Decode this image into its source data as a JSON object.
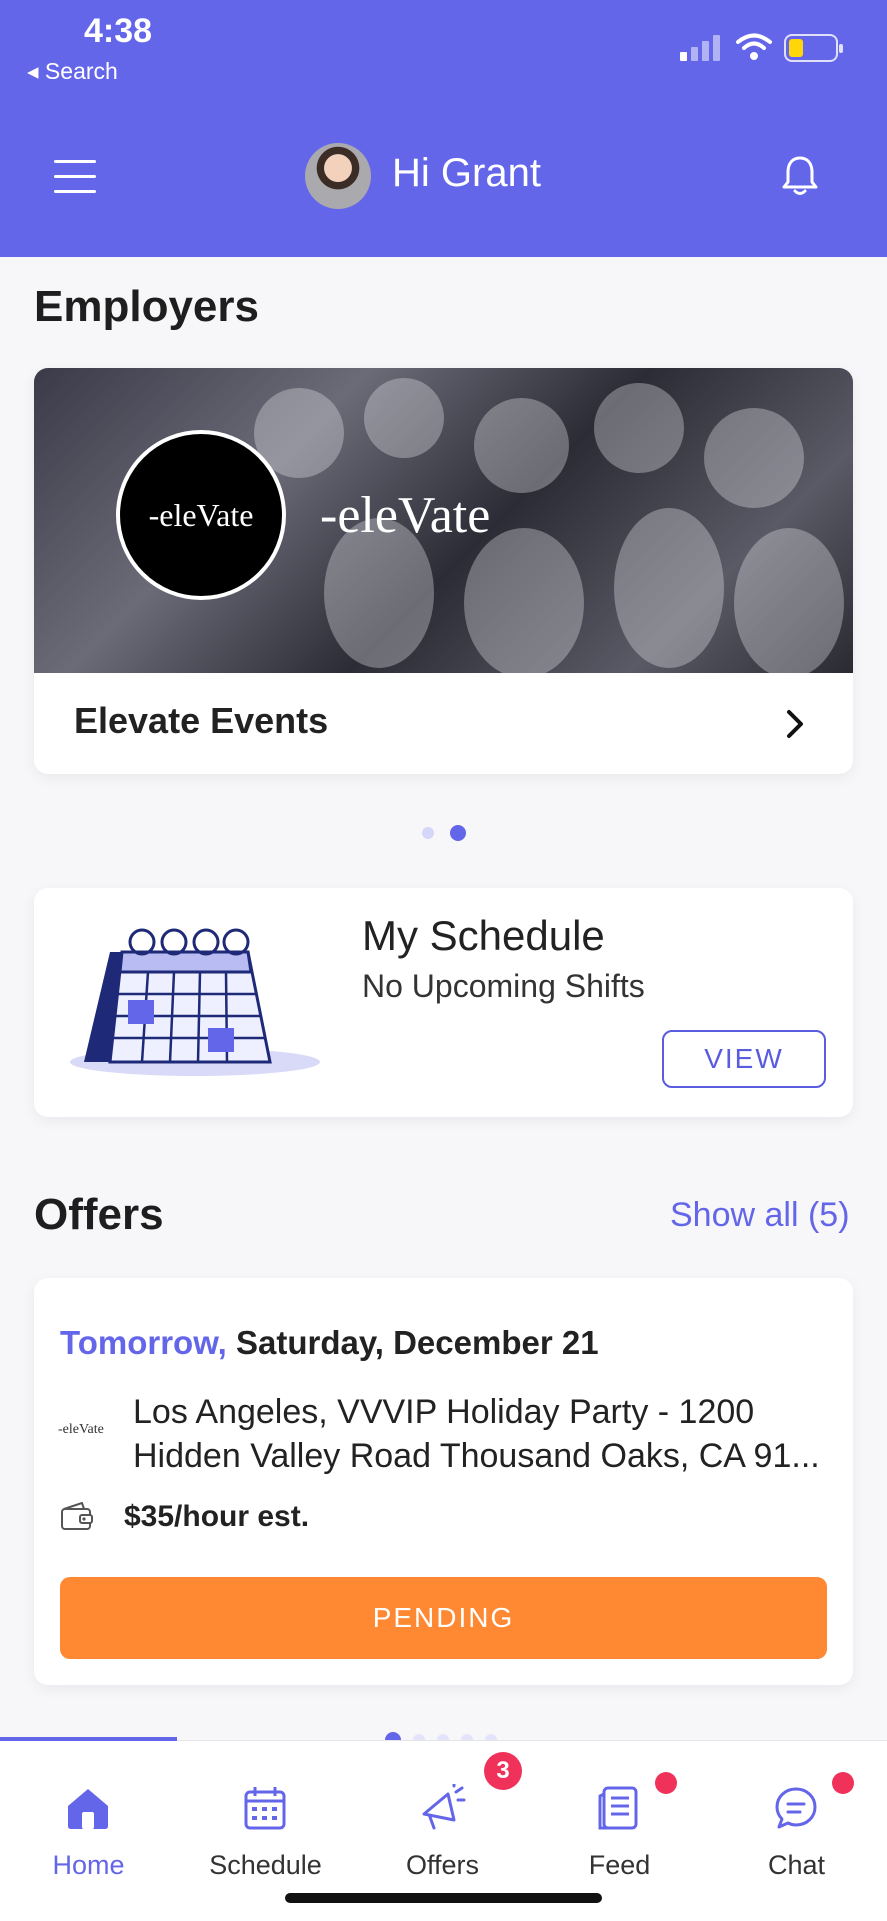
{
  "status_bar": {
    "time": "4:38",
    "back_label": "◂ Search"
  },
  "header": {
    "greeting": "Hi Grant"
  },
  "employers": {
    "title": "Employers",
    "card": {
      "logo_text": "-eleVate",
      "wordmark": "-eleVate",
      "name": "Elevate Events"
    },
    "carousel": {
      "count": 2,
      "active_index": 1
    }
  },
  "schedule": {
    "title": "My Schedule",
    "subtitle": "No Upcoming Shifts",
    "view_label": "VIEW"
  },
  "offers": {
    "title": "Offers",
    "show_all": "Show all (5)",
    "card": {
      "date_prefix": "Tomorrow,",
      "date": "Saturday, December 21",
      "logo_text": "-eleVate",
      "location": "Los Angeles, VVVIP Holiday Party - 1200 Hidden Valley Road Thousand Oaks, CA 91...",
      "pay": "$35/hour est.",
      "status_label": "PENDING"
    },
    "carousel": {
      "count": 5,
      "active_index": 0
    }
  },
  "tabbar": {
    "active_color": "#6466e9",
    "tabs": [
      {
        "label": "Home",
        "icon": "home-icon",
        "active": true
      },
      {
        "label": "Schedule",
        "icon": "calendar-icon",
        "active": false
      },
      {
        "label": "Offers",
        "icon": "megaphone-icon",
        "active": false,
        "badge": "3"
      },
      {
        "label": "Feed",
        "icon": "feed-icon",
        "active": false,
        "dot": true
      },
      {
        "label": "Chat",
        "icon": "chat-icon",
        "active": false,
        "dot": true
      }
    ]
  },
  "colors": {
    "brand": "#6466e9",
    "pending": "#ff8833",
    "badge": "#f0325a"
  }
}
